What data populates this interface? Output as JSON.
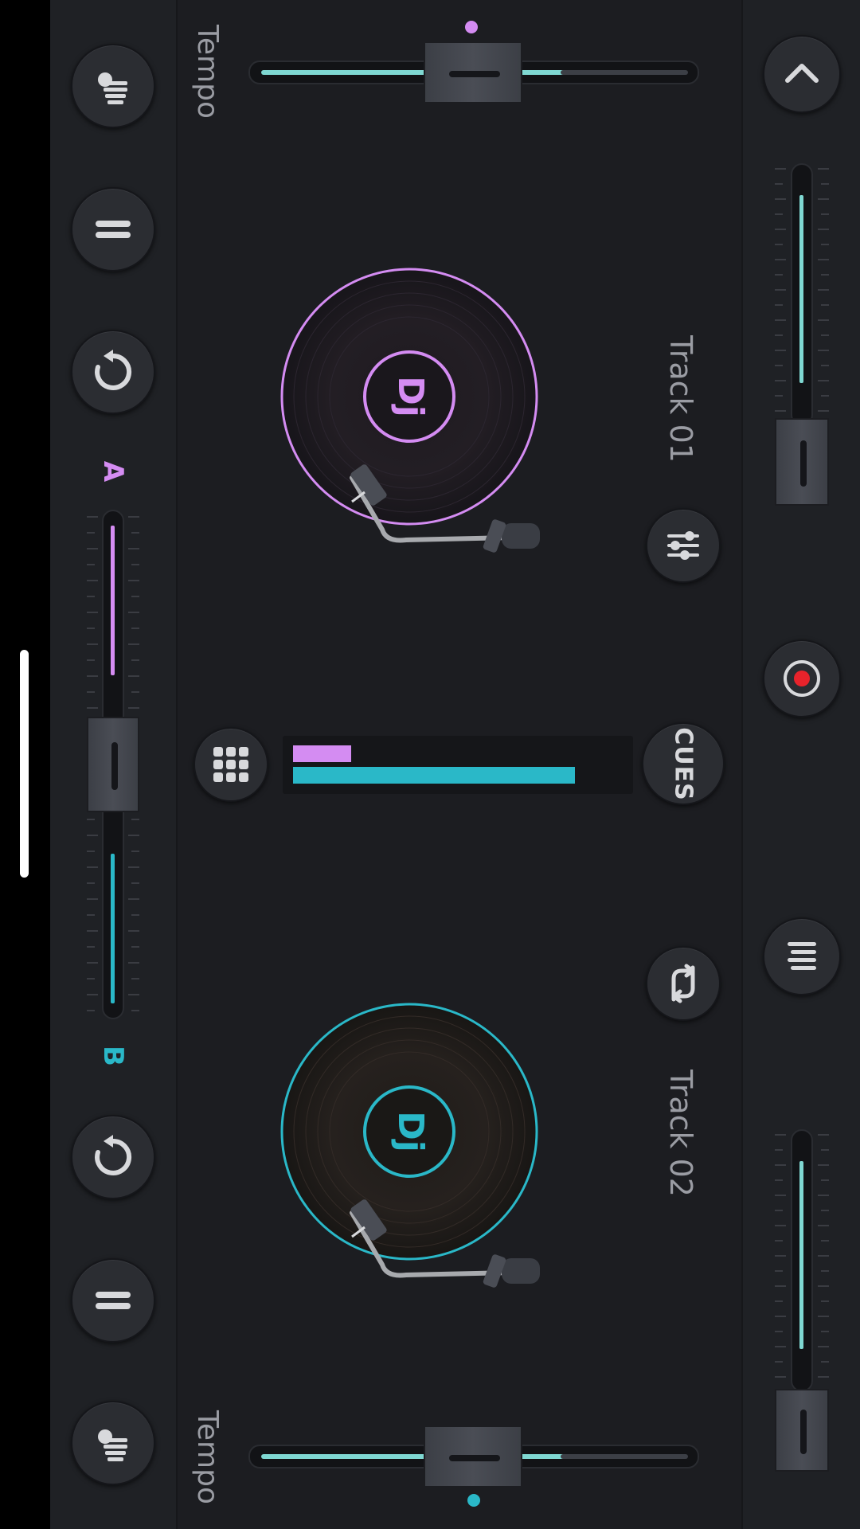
{
  "colors": {
    "deck_a": "#d48cf2",
    "deck_b": "#2ab8c8",
    "tempo_fill": "#7fd8d2",
    "record": "#e8232b",
    "text": "#9a9ca3"
  },
  "deck_a": {
    "tempo_label": "Tempo",
    "track_label": "Track 01",
    "disc_label": "Dj",
    "tempo_level": 0.47,
    "volume_level": 0.78,
    "buttons": [
      "tap-tempo-icon",
      "pause-icon",
      "reverse-icon"
    ]
  },
  "deck_b": {
    "tempo_label": "Tempo",
    "track_label": "Track 02",
    "disc_label": "Dj",
    "tempo_level": 0.47,
    "volume_level": 0.78,
    "buttons": [
      "tap-tempo-icon",
      "pause-icon",
      "reverse-icon"
    ]
  },
  "crossfader": {
    "label_a": "A",
    "label_b": "B",
    "position": 0.5
  },
  "center": {
    "cues_label": "CUES",
    "level_a": 0.17,
    "level_b": 0.83
  },
  "right_panel": {
    "icons": [
      "chevron-up-icon",
      "record-icon",
      "menu-icon"
    ]
  }
}
